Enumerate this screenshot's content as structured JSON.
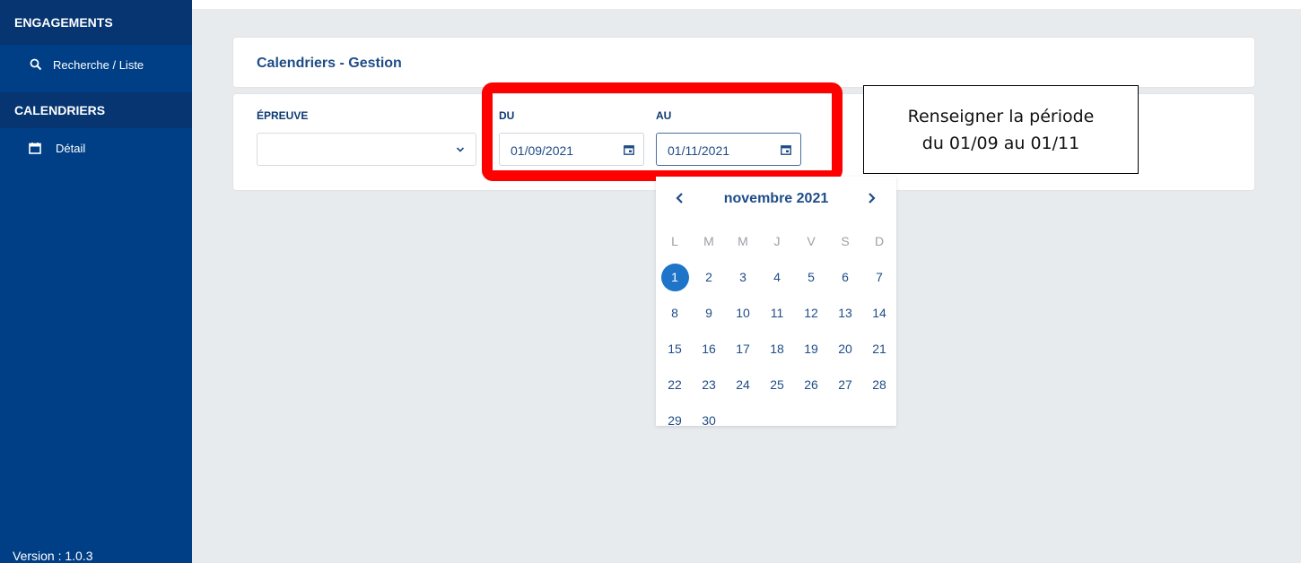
{
  "sidebar": {
    "section1": "ENGAGEMENTS",
    "item1": "Recherche / Liste",
    "section2": "CALENDRIERS",
    "item2": "Détail",
    "version": "Version : 1.0.3"
  },
  "header": {
    "title": "Calendriers - Gestion"
  },
  "form": {
    "epreuve_label": "ÉPREUVE",
    "epreuve_value": "",
    "du_label": "DU",
    "du_value": "01/09/2021",
    "au_label": "AU",
    "au_value": "01/11/2021"
  },
  "annotation": {
    "line1": "Renseigner la période",
    "line2": "du 01/09 au 01/11"
  },
  "datepicker": {
    "month": "novembre 2021",
    "weekdays": [
      "L",
      "M",
      "M",
      "J",
      "V",
      "S",
      "D"
    ],
    "weeks": [
      [
        "1",
        "2",
        "3",
        "4",
        "5",
        "6",
        "7"
      ],
      [
        "8",
        "9",
        "10",
        "11",
        "12",
        "13",
        "14"
      ],
      [
        "15",
        "16",
        "17",
        "18",
        "19",
        "20",
        "21"
      ],
      [
        "22",
        "23",
        "24",
        "25",
        "26",
        "27",
        "28"
      ],
      [
        "29",
        "30",
        "",
        "",
        "",
        "",
        ""
      ]
    ],
    "selected": "1"
  },
  "colors": {
    "sidebar": "#003f86",
    "accent": "#1e74c8",
    "highlight": "#ff0000",
    "text": "#1f4c87"
  }
}
